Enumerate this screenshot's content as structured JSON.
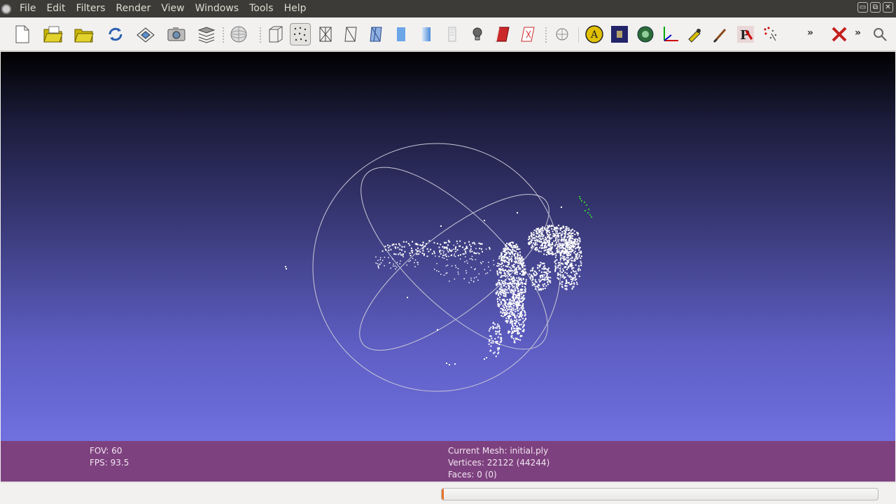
{
  "menu": {
    "items": [
      "File",
      "Edit",
      "Filters",
      "Render",
      "View",
      "Windows",
      "Tools",
      "Help"
    ]
  },
  "window_controls": {
    "minimize": "▭",
    "restore": "⧉",
    "close": "✕"
  },
  "toolbar": {
    "overflow_1": "»",
    "overflow_2": "»",
    "active_tool": "points-render-button"
  },
  "viewport": {
    "background_top": "#000000",
    "background_bottom": "#7070e0",
    "point_color": "#ffffff",
    "selected_point_color": "#32c832",
    "trackball_color": "#c8c8d8"
  },
  "info": {
    "fov": "FOV: 60",
    "fps": "FPS:   93.5",
    "current_mesh": "Current Mesh: initial.ply",
    "vertices": "Vertices: 22122 (44244)",
    "faces": "Faces: 0 (0)"
  },
  "status": {
    "progress_percent": 0.5
  },
  "colors": {
    "menubar": "#3c3b37",
    "infobar": "#7e417f",
    "accent": "#e8722a"
  }
}
